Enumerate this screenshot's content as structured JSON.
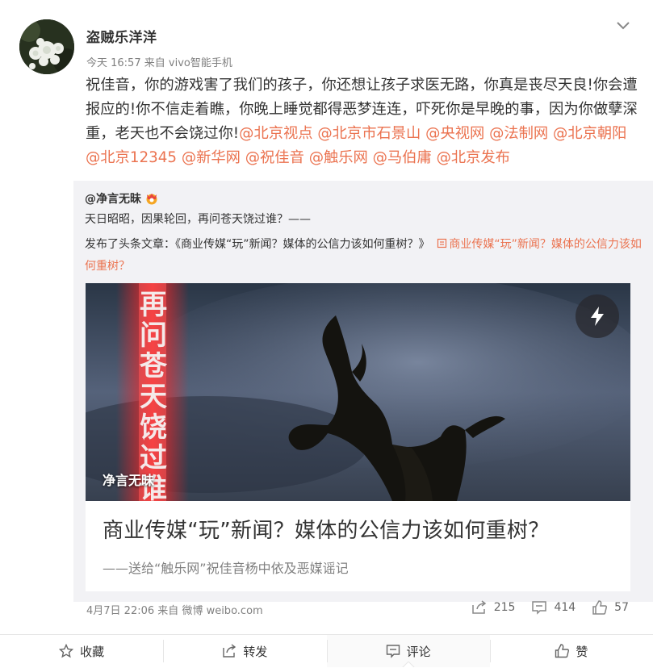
{
  "post": {
    "username": "盗贼乐洋洋",
    "time": "今天 16:57",
    "from": "来自",
    "device": "vivo智能手机",
    "text_plain": "祝佳音，你的游戏害了我们的孩子，你还想让孩子求医无路，你真是丧尽天良!你会遭报应的!你不信走着瞧，你晚上睡觉都得恶梦连连，吓死你是早晚的事，因为你做孽深重，老天也不会饶过你!",
    "mentions": [
      "@北京视点",
      "@北京市石景山",
      "@央视网",
      "@法制网",
      "@北京朝阳",
      "@北京12345",
      "@新华网",
      "@祝佳音",
      "@触乐网",
      "@马伯庸",
      "@北京发布"
    ]
  },
  "repost": {
    "user": "@净言无昧",
    "badge_icon": "vip-crown-icon",
    "line1": "天日昭昭，因果轮回，再问苍天饶过谁？——",
    "line2_prefix": "发布了头条文章：《商业传媒“玩”新闻？媒体的公信力该如何重树？》",
    "article_link": "商业传媒“玩”新闻？媒体的公信力该如何重树？",
    "card": {
      "cover_text": "再问苍天饶过谁",
      "cover_label": "净言无昧",
      "title": "商业传媒“玩”新闻？媒体的公信力该如何重树？",
      "subtitle": "——送给“触乐网”祝佳音杨中依及恶媒谣记"
    },
    "date": "4月7日 22:06",
    "from": "来自",
    "source": "微博 weibo.com",
    "stats": {
      "reposts": "215",
      "comments": "414",
      "likes": "57"
    }
  },
  "actions": {
    "favorite": "收藏",
    "repost": "转发",
    "comment": "评论",
    "like": "赞"
  },
  "colors": {
    "link": "#eb7350",
    "meta": "#808080",
    "repost_bg": "#f2f2f5"
  }
}
